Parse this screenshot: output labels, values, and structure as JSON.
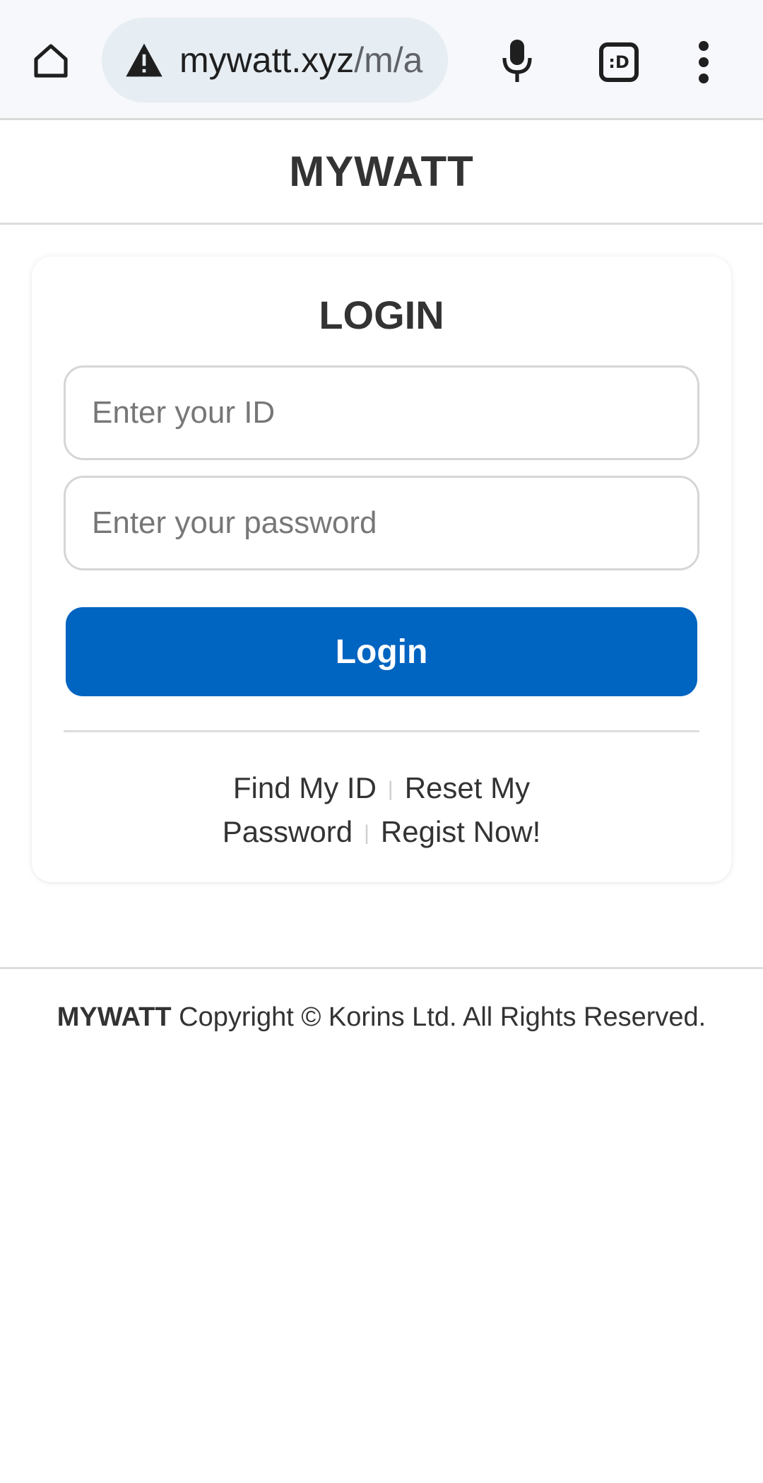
{
  "browser": {
    "url_domain": "mywatt.xyz",
    "url_path": "/m/a",
    "tabs_icon_text": ":D",
    "icons": {
      "home": "home-icon",
      "warning": "warning-icon",
      "mic": "mic-icon",
      "tabs": "tab-switcher-icon",
      "menu": "more-vert-icon"
    }
  },
  "header": {
    "brand": "MYWATT"
  },
  "login": {
    "title": "LOGIN",
    "id_placeholder": "Enter your ID",
    "password_placeholder": "Enter your password",
    "button_label": "Login",
    "links": {
      "find_id": "Find My ID",
      "reset_password": "Reset My Password",
      "register": "Regist Now!",
      "separator": "|"
    }
  },
  "footer": {
    "brand": "MYWATT",
    "copyright": "Copyright © Korins Ltd. All Rights Reserved."
  },
  "colors": {
    "primary_button": "#0064c1",
    "text": "#333333",
    "chrome_bg": "#f7f8fb",
    "url_pill_bg": "#e6edf3"
  }
}
